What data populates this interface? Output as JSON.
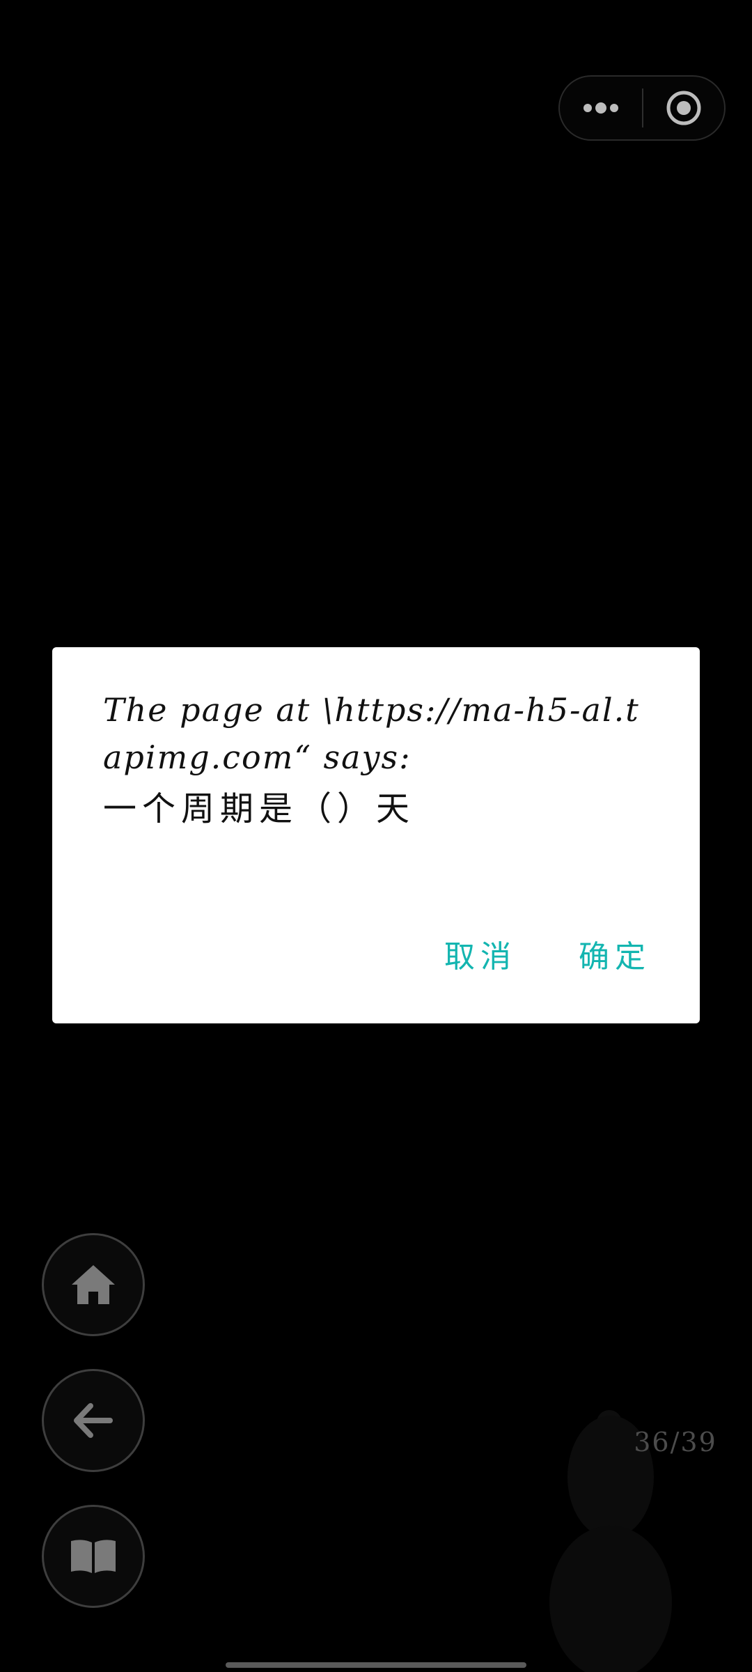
{
  "capsule": {
    "more_icon": "more-dots-icon",
    "close_icon": "target-circle-icon"
  },
  "dialog": {
    "title": "The page at \\https://ma-h5-al.tapimg.com“ says:",
    "message": "一个周期是（）天",
    "cancel_label": "取消",
    "ok_label": "确定",
    "accent_color": "#13b5b0"
  },
  "nav": {
    "home_icon": "home-icon",
    "back_icon": "arrow-left-icon",
    "book_icon": "open-book-icon"
  },
  "page_counter": "36/39"
}
